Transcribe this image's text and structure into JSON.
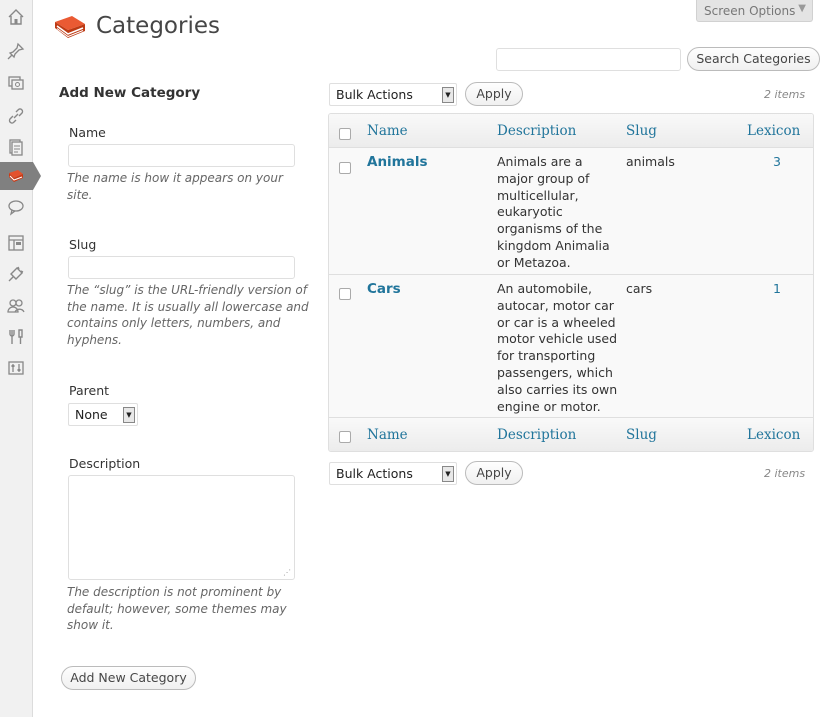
{
  "sidebar": {
    "items": [
      "dashboard-icon",
      "posts-icon",
      "media-icon",
      "links-icon",
      "pages-icon",
      "lexicon-icon",
      "comments-icon",
      "appearance-icon",
      "plugins-icon",
      "users-icon",
      "tools-icon",
      "settings-icon"
    ]
  },
  "header": {
    "screen_options": "Screen Options",
    "title": "Categories"
  },
  "search": {
    "value": "",
    "button": "Search Categories"
  },
  "form": {
    "heading": "Add New Category",
    "name_label": "Name",
    "name_hint": "The name is how it appears on your site.",
    "slug_label": "Slug",
    "slug_hint": "The “slug” is the URL-friendly version of the name. It is usually all lowercase and contains only letters, numbers, and hyphens.",
    "parent_label": "Parent",
    "parent_value": "None",
    "description_label": "Description",
    "description_hint": "The description is not prominent by default; however, some themes may show it.",
    "submit": "Add New Category"
  },
  "bulk": {
    "top_select": "Bulk Actions",
    "top_apply": "Apply",
    "top_count": "2 items",
    "bottom_select": "Bulk Actions",
    "bottom_apply": "Apply",
    "bottom_count": "2 items"
  },
  "table": {
    "columns": [
      "Name",
      "Description",
      "Slug",
      "Lexicon"
    ],
    "rows": [
      {
        "name": "Animals",
        "description": "Animals are a major group of multicellular, eukaryotic organisms of the kingdom Animalia or Metazoa.",
        "slug": "animals",
        "count": "3"
      },
      {
        "name": "Cars",
        "description": "An automobile, autocar, motor car or car is a wheeled motor vehicle used for transporting passengers, which also carries its own engine or motor.",
        "slug": "cars",
        "count": "1"
      }
    ]
  },
  "colors": {
    "link": "#21759b",
    "accent": "#d54e21"
  }
}
